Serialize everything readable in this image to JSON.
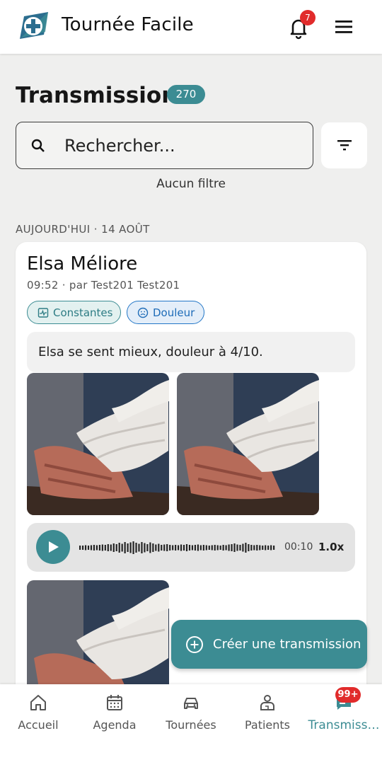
{
  "header": {
    "app_title": "Tournée Facile",
    "notification_count": "7",
    "logo_icon": "medical-cross-logo-icon",
    "notification_icon": "bell-icon",
    "menu_icon": "hamburger-menu-icon"
  },
  "page": {
    "title": "Transmissions",
    "count": "270",
    "search_placeholder": "Rechercher...",
    "filter_status": "Aucun filtre"
  },
  "feed": {
    "date_header": "AUJOURD'HUI · 14 AOÛT",
    "items": [
      {
        "patient": "Elsa Méliore",
        "meta": "09:52 · par Test201 Test201",
        "tags": [
          "Constantes",
          "Douleur"
        ],
        "note": "Elsa se sent mieux, douleur à 4/10.",
        "audio": {
          "duration": "00:10",
          "speed": "1.0x"
        }
      }
    ]
  },
  "fab": {
    "label": "Créer une transmission"
  },
  "nav": {
    "items": [
      {
        "label": "Accueil",
        "icon": "home-icon"
      },
      {
        "label": "Agenda",
        "icon": "calendar-icon"
      },
      {
        "label": "Tournées",
        "icon": "car-icon"
      },
      {
        "label": "Patients",
        "icon": "patient-icon"
      },
      {
        "label": "Transmiss…",
        "icon": "chat-icon"
      }
    ],
    "active_index": 4,
    "badge": "99+"
  },
  "colors": {
    "accent": "#3c8c93",
    "badge": "#e12b2b",
    "pain_chip": "#2377c7"
  }
}
